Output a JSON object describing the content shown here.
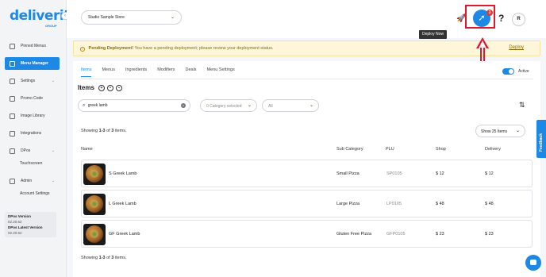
{
  "app": {
    "logo_text": "deliverit",
    "logo_sub": "GROUP",
    "brand_color": "#1e88e5"
  },
  "sidebar": {
    "items": [
      {
        "label": "Pinned Menus",
        "icon": "pin-icon"
      },
      {
        "label": "Menu Manager",
        "icon": "menu-icon",
        "active": true
      },
      {
        "label": "Settings",
        "icon": "gear-icon",
        "has_children": true
      },
      {
        "label": "Promo Code",
        "icon": "tag-icon"
      },
      {
        "label": "Image Library",
        "icon": "image-icon"
      },
      {
        "label": "Integrations",
        "icon": "plug-icon"
      },
      {
        "label": "DPos",
        "icon": "pos-icon",
        "has_children": true
      },
      {
        "label": "Admin",
        "icon": "admin-icon",
        "has_children": true
      }
    ],
    "subitems": {
      "dpos": "Touchscreen",
      "admin": "Account Settings"
    },
    "version": {
      "dpos_version_label": "DPos Version",
      "dpos_version": "02.20.62",
      "dpos_latest_label": "DPos Latest Version",
      "dpos_latest": "02.20.62"
    }
  },
  "topbar": {
    "store_select": "Studio Sample Store",
    "deploy_badge_count": "3",
    "deploy_tooltip": "Deploy Now",
    "help_label": "?",
    "avatar_initial": "R"
  },
  "alert": {
    "title": "Pending Deployment!",
    "message": "You have a pending deployment; please review your deployment status.",
    "action": "Deploy",
    "color": "#8a6d0a"
  },
  "tabs": [
    {
      "label": "Items",
      "active": true
    },
    {
      "label": "Menus"
    },
    {
      "label": "Ingredients"
    },
    {
      "label": "Modifiers"
    },
    {
      "label": "Deals"
    },
    {
      "label": "Menu Settings"
    }
  ],
  "active_toggle": {
    "label": "Active",
    "on": true
  },
  "items_section": {
    "title": "Items",
    "search_value": "greek lamb",
    "category_placeholder": "0 Category selected",
    "status_filter": "All",
    "showing_prefix": "Showing ",
    "showing_range": "1-3",
    "showing_of": " of ",
    "showing_total": "3",
    "showing_suffix": " items.",
    "page_size": "Show 25 Items"
  },
  "table": {
    "headers": {
      "name": "Name",
      "sub_category": "Sub Category",
      "plu": "PLU",
      "shop": "Shop",
      "delivery": "Delivery"
    },
    "rows": [
      {
        "name": "S Greek Lamb",
        "sub_category": "Small Pizza",
        "plu": "SP0105",
        "shop": "$ 12",
        "delivery": "$ 12"
      },
      {
        "name": "L Greek Lamb",
        "sub_category": "Large Pizza",
        "plu": "LP0105",
        "shop": "$ 48",
        "delivery": "$ 48"
      },
      {
        "name": "GF Greek Lamb",
        "sub_category": "Gluten Free Pizza",
        "plu": "GFP0105",
        "shop": "$ 23",
        "delivery": "$ 23"
      }
    ]
  },
  "feedback_label": "Feedback"
}
